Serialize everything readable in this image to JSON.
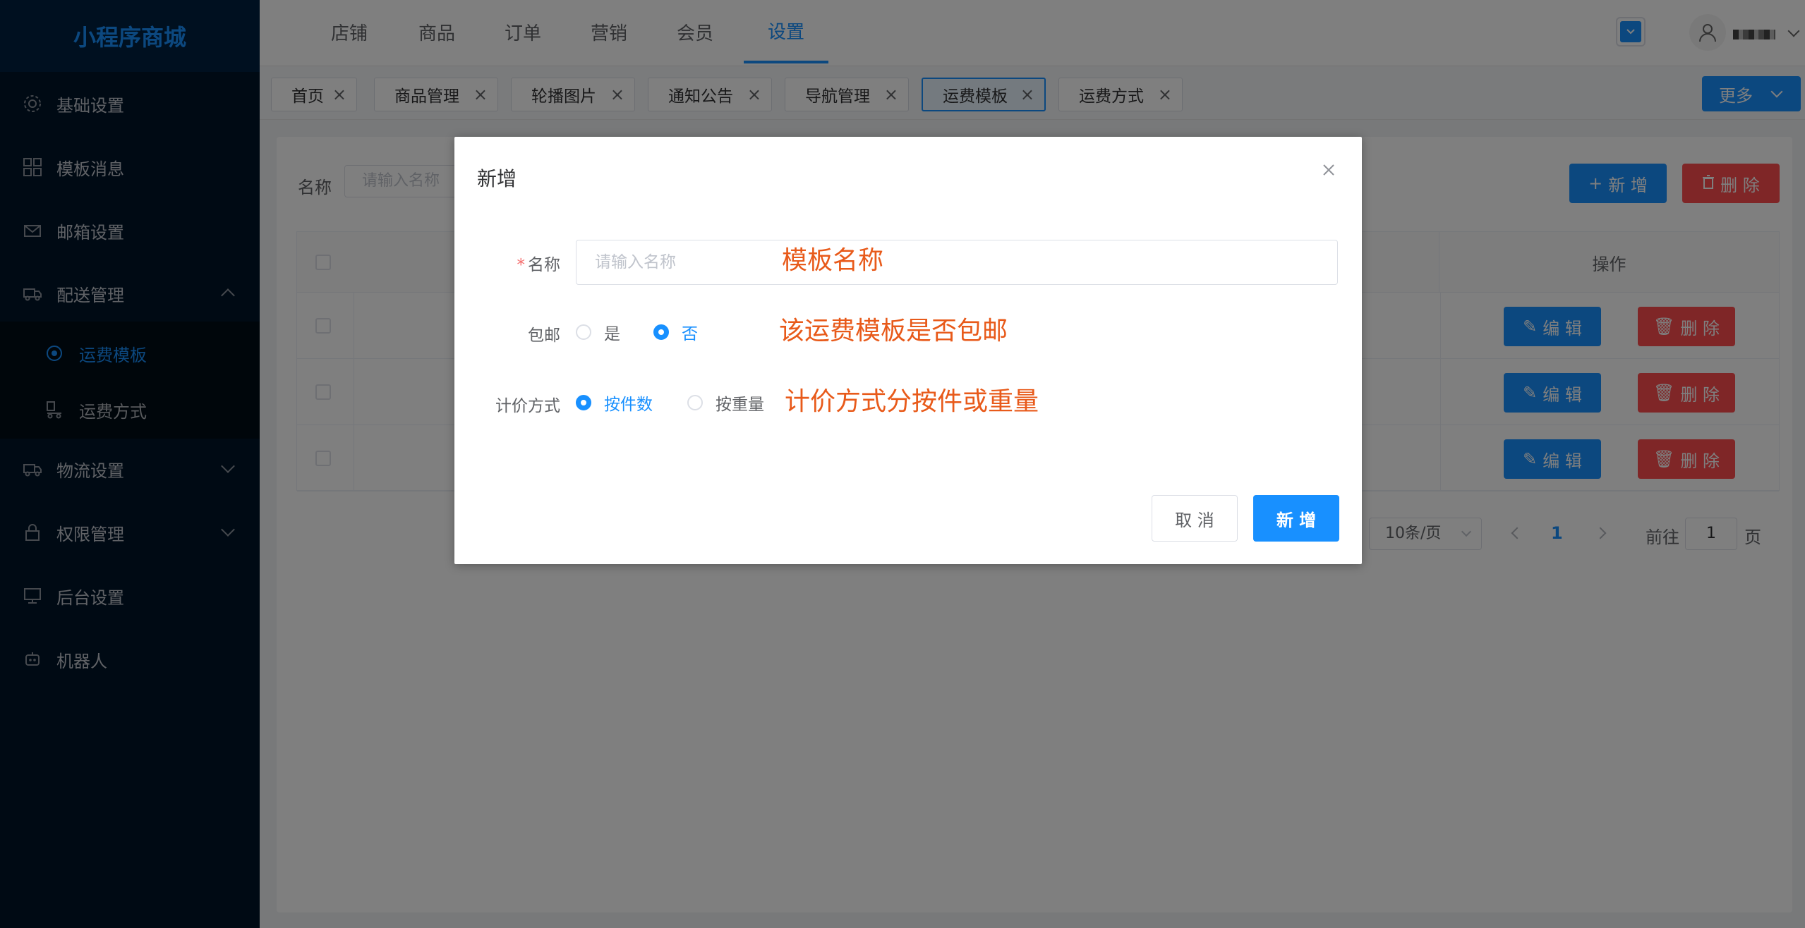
{
  "app": {
    "logo": "小程序商城"
  },
  "sidebar": {
    "items": [
      {
        "label": "基础设置",
        "icon": "gear-icon"
      },
      {
        "label": "模板消息",
        "icon": "grid-icon"
      },
      {
        "label": "邮箱设置",
        "icon": "mail-icon"
      },
      {
        "label": "配送管理",
        "icon": "truck-icon"
      },
      {
        "label": "物流设置",
        "icon": "truck-icon"
      },
      {
        "label": "权限管理",
        "icon": "lock-icon"
      },
      {
        "label": "后台设置",
        "icon": "monitor-icon"
      },
      {
        "label": "机器人",
        "icon": "robot-icon"
      }
    ],
    "submenu": [
      {
        "label": "运费模板",
        "icon": "circle-dot-icon",
        "active": true
      },
      {
        "label": "运费方式",
        "icon": "delivery-icon",
        "active": false
      }
    ]
  },
  "topnav": {
    "items": [
      "店铺",
      "商品",
      "订单",
      "营销",
      "会员",
      "设置"
    ],
    "active": "设置"
  },
  "tags": {
    "items": [
      "首页",
      "商品管理",
      "轮播图片",
      "通知公告",
      "导航管理",
      "运费模板",
      "运费方式"
    ],
    "active": "运费模板",
    "more_label": "更多"
  },
  "main": {
    "search_label": "名称",
    "search_placeholder": "请输入名称",
    "add_label": "新 增",
    "delete_label": "删 除",
    "table": {
      "ops_header": "操作",
      "edit_label": "编 辑",
      "row_delete_label": "删 除",
      "row_count": 3
    },
    "pagination": {
      "page_size": "10条/页",
      "current_page": "1",
      "goto_label": "前往",
      "goto_value": "1",
      "page_suffix": "页"
    }
  },
  "dialog": {
    "title": "新增",
    "name_label": "名称",
    "name_placeholder": "请输入名称",
    "name_note": "模板名称",
    "free_shipping_label": "包邮",
    "free_shipping_options": [
      "是",
      "否"
    ],
    "free_shipping_selected": "否",
    "free_shipping_note": "该运费模板是否包邮",
    "pricing_label": "计价方式",
    "pricing_options": [
      "按件数",
      "按重量"
    ],
    "pricing_selected": "按件数",
    "pricing_note": "计价方式分按件或重量",
    "cancel_label": "取 消",
    "confirm_label": "新 增"
  },
  "colors": {
    "accent": "#1890ff",
    "danger": "#ff4d4f",
    "sidebar_bg": "#001529",
    "annotation": "#e85a1a"
  }
}
